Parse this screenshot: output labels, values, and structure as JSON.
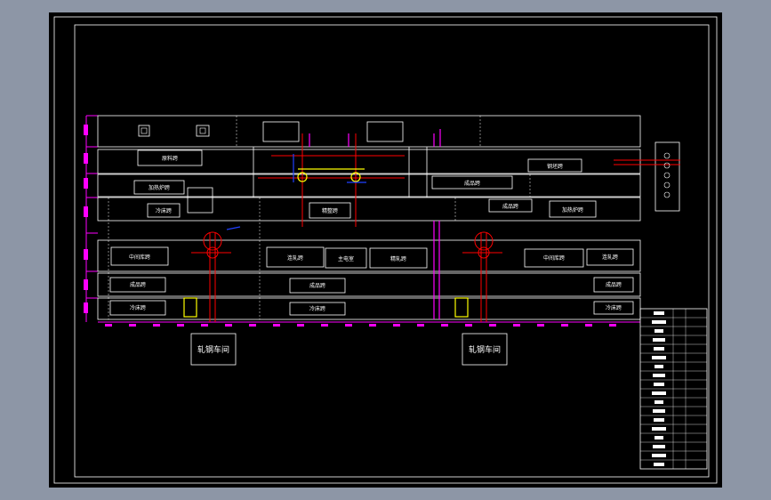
{
  "colors": {
    "viewport": "#8d96a6",
    "sheet": "#000000",
    "line": "#ffffff",
    "accent_magenta": "#ff00ff",
    "accent_red": "#ff0000",
    "accent_yellow": "#ffff00",
    "accent_blue": "#2040ff"
  },
  "labels": {
    "hall_left": "轧钢车间",
    "hall_right": "轧钢车间",
    "row2_a": "原料跨",
    "row3_a": "加热炉跨",
    "row3_b": "成品跨",
    "row3_c": "钢坯跨",
    "row4_a": "冷床跨",
    "row4_b": "精整跨",
    "row4_c": "成品跨",
    "row4_d": "加热炉跨",
    "row5_a": "中间库跨",
    "row5_b": "连轧跨",
    "row5_c": "主电室",
    "row5_d": "精轧跨",
    "row5_e": "中间库跨",
    "row5_f": "连轧跨",
    "row6_a": "成品跨",
    "row6_b": "成品跨",
    "row6_c": "成品跨",
    "row7_a": "冷床跨",
    "row7_b": "冷床跨",
    "row7_c": "冷床跨"
  }
}
